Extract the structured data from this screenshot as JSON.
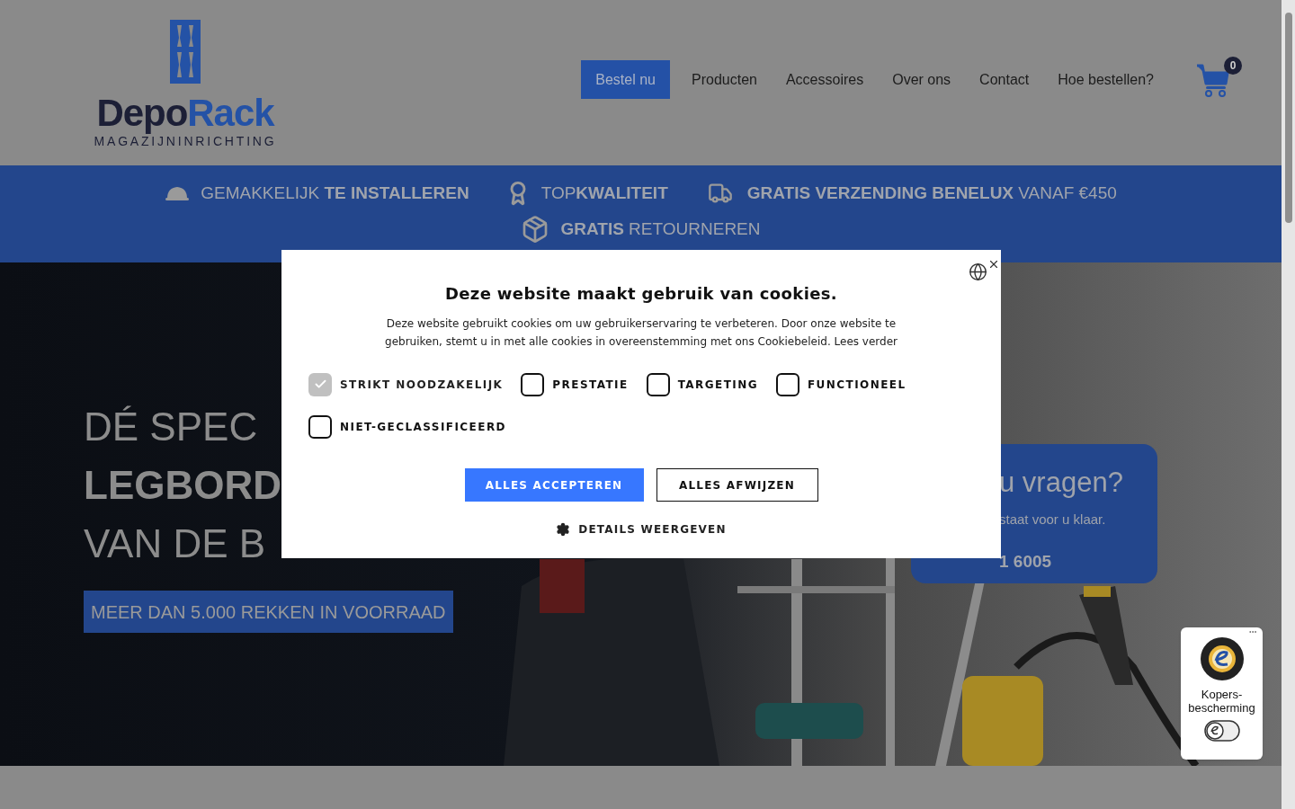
{
  "logo": {
    "name_dark": "Depo",
    "name_blue": "Rack",
    "tagline": "MAGAZIJNINRICHTING"
  },
  "nav": [
    {
      "label": "Bestel nu",
      "kind": "cta"
    },
    {
      "label": "Producten",
      "kind": "link"
    },
    {
      "label": "Accessoires",
      "kind": "link"
    },
    {
      "label": "Over ons",
      "kind": "link"
    },
    {
      "label": "Contact",
      "kind": "link"
    },
    {
      "label": "Hoe bestellen?",
      "kind": "link"
    }
  ],
  "cart": {
    "count": "0"
  },
  "usps": [
    {
      "text": "GEMAKKELIJK **TE INSTALLEREN**"
    },
    {
      "text": "TOP**KWALITEIT**"
    },
    {
      "text": "**GRATIS VERZENDING BENELUX** VANAF €450"
    },
    {
      "text": "**GRATIS** RETOURNEREN"
    }
  ],
  "hero": {
    "lines": [
      {
        "text": "DÉ SPEC",
        "bold": false
      },
      {
        "text": "LEGBORD",
        "bold": true
      },
      {
        "text": "VAN DE B",
        "bold": false
      }
    ],
    "badge": "MEER DAN 5.000 REKKEN IN VOORRAAD",
    "contact_card": {
      "title": "u vragen?",
      "text": "staat voor u klaar.",
      "phone": "1 6005"
    }
  },
  "cookie_dialog": {
    "title": "Deze website maakt gebruik van cookies.",
    "text": "Deze website gebruikt cookies om uw gebruikerservaring te verbeteren. Door onze website te gebruiken, stemt u in met alle cookies in overeenstemming met ons Cookiebeleid. Lees verder",
    "categories": [
      {
        "label": "STRIKT NOODZAKELIJK",
        "checked": true,
        "disabled": true
      },
      {
        "label": "PRESTATIE",
        "checked": false,
        "disabled": false
      },
      {
        "label": "TARGETING",
        "checked": false,
        "disabled": false
      },
      {
        "label": "FUNCTIONEEL",
        "checked": false,
        "disabled": false
      },
      {
        "label": "NIET-GECLASSIFICEERD",
        "checked": false,
        "disabled": false
      }
    ],
    "buttons": [
      {
        "label": "ALLES ACCEPTEREN",
        "kind": "primary"
      },
      {
        "label": "ALLES AFWIJZEN",
        "kind": "secondary"
      }
    ],
    "details": "DETAILS WEERGEVEN"
  },
  "trust_badge": {
    "text": "Kopers-bescherming"
  }
}
